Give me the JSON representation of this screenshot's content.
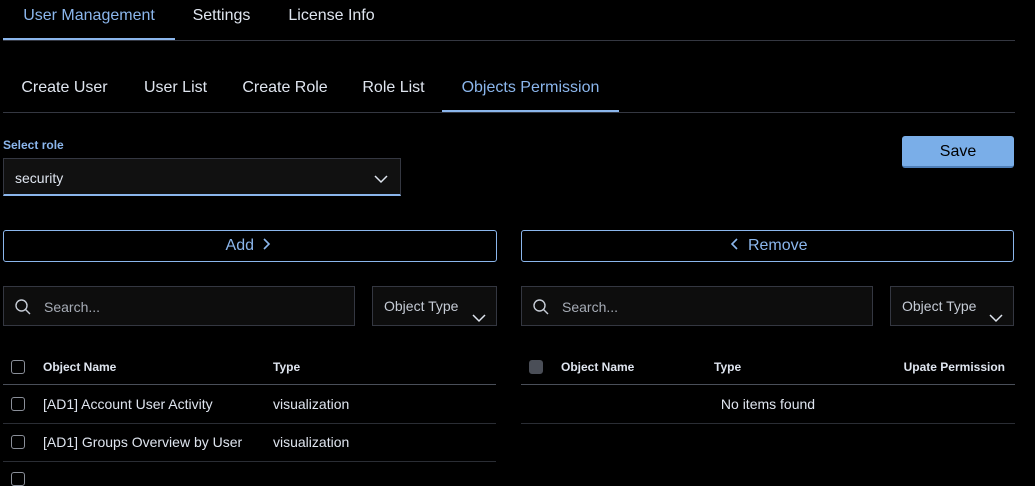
{
  "top_tabs": [
    "User Management",
    "Settings",
    "License Info"
  ],
  "sub_tabs": [
    "Create User",
    "User List",
    "Create Role",
    "Role List",
    "Objects Permission"
  ],
  "role": {
    "label": "Select role",
    "value": "security"
  },
  "save_label": "Save",
  "add_label": "Add",
  "remove_label": "Remove",
  "left": {
    "search_placeholder": "Search...",
    "type_filter": "Object Type",
    "columns": [
      "Object Name",
      "Type"
    ],
    "rows": [
      {
        "name": "[AD1] Account User Activity",
        "type": "visualization"
      },
      {
        "name": "[AD1] Groups Overview by User",
        "type": "visualization"
      }
    ]
  },
  "right": {
    "search_placeholder": "Search...",
    "type_filter": "Object Type",
    "columns": [
      "Object Name",
      "Type",
      "Upate Permission"
    ],
    "empty": "No items found"
  },
  "colors": {
    "accent": "#8bb6ec",
    "primary_button": "#7aaee8",
    "background": "#000000"
  }
}
